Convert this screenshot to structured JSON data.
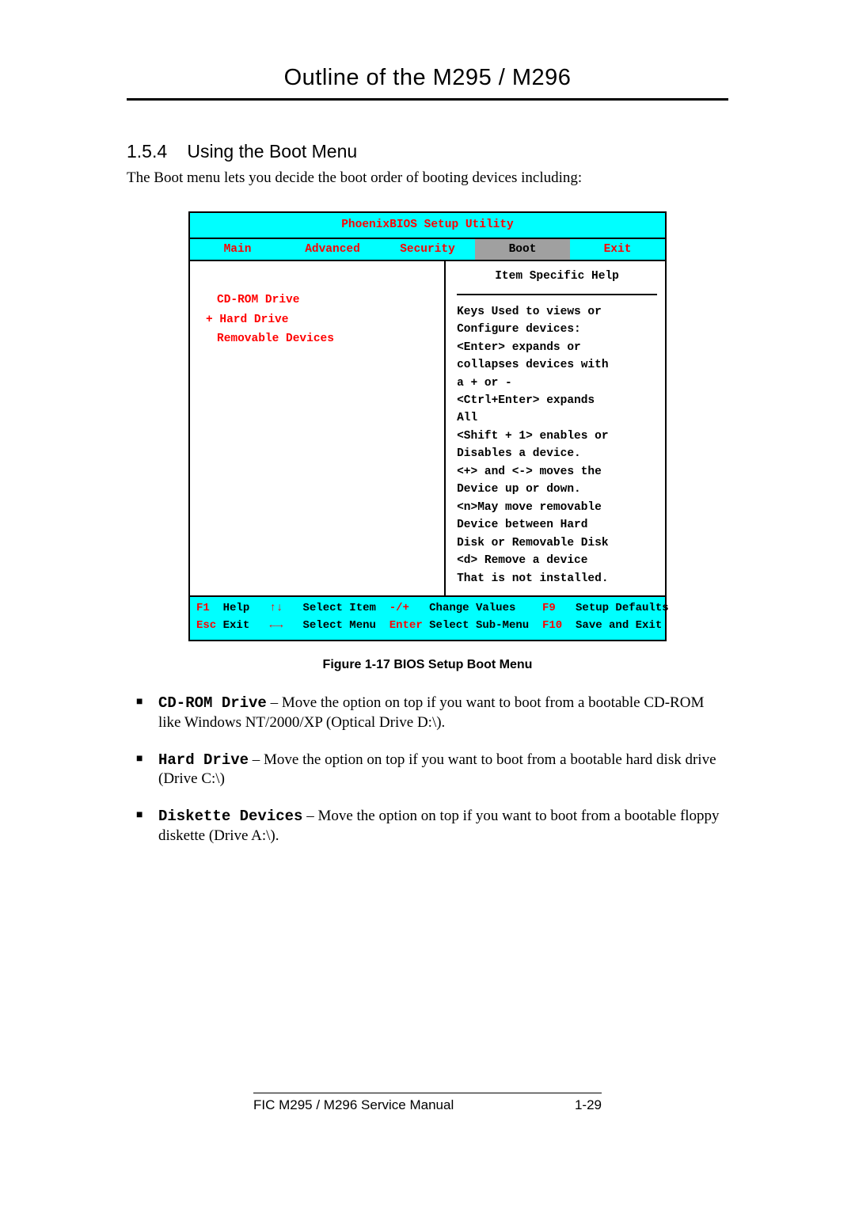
{
  "header_title": "Outline of the M295 / M296",
  "section": {
    "number": "1.5.4",
    "title": "Using the Boot Menu"
  },
  "intro": "The Boot menu lets you decide the boot order of booting devices including:",
  "bios": {
    "title": "PhoenixBIOS Setup Utility",
    "tabs": [
      "Main",
      "Advanced",
      "Security",
      "Boot",
      "Exit"
    ],
    "selected_tab": "Boot",
    "left_items": [
      {
        "text": "CD-ROM Drive",
        "plus": false
      },
      {
        "text": "+ Hard Drive",
        "plus": true
      },
      {
        "text": "Removable Devices",
        "plus": false
      }
    ],
    "help_title": "Item Specific Help",
    "help_lines": [
      "Keys Used to views or",
      "Configure devices:",
      "<Enter> expands or",
      "collapses devices with",
      "a + or -",
      "<Ctrl+Enter> expands",
      "All",
      "<Shift + 1> enables or",
      "Disables a device.",
      "<+> and <-> moves the",
      "Device up or down.",
      "<n>May move removable",
      "Device between Hard",
      "Disk or Removable Disk",
      "<d> Remove a device",
      "That is not installed."
    ],
    "bottom": {
      "r1": {
        "k1": "F1",
        "l1": "Help",
        "k2": "↑↓",
        "l2": "Select Item",
        "k3": "-/+",
        "l3": "Change Values",
        "k4": "F9",
        "l4": "Setup Defaults"
      },
      "r2": {
        "k1": "Esc",
        "l1": "Exit",
        "k2": "←→",
        "l2": "Select Menu",
        "k3": "Enter",
        "l3": "Select Sub-Menu",
        "k4": "F10",
        "l4": "Save and Exit"
      }
    }
  },
  "figure_caption": "Figure 1-17     BIOS Setup Boot Menu",
  "bullets": [
    {
      "name": "CD-ROM Drive",
      "desc": " – Move the option on top if you want to boot from a bootable CD-ROM like Windows NT/2000/XP (Optical Drive D:\\)."
    },
    {
      "name": "Hard Drive",
      "desc": " – Move the option on top if you want to boot from a bootable hard disk drive (Drive C:\\)"
    },
    {
      "name": "Diskette Devices",
      "desc": " – Move the option on top if you want to boot from a bootable floppy diskette (Drive A:\\)."
    }
  ],
  "footer": {
    "left": "FIC M295 / M296 Service Manual",
    "right": "1-29"
  }
}
